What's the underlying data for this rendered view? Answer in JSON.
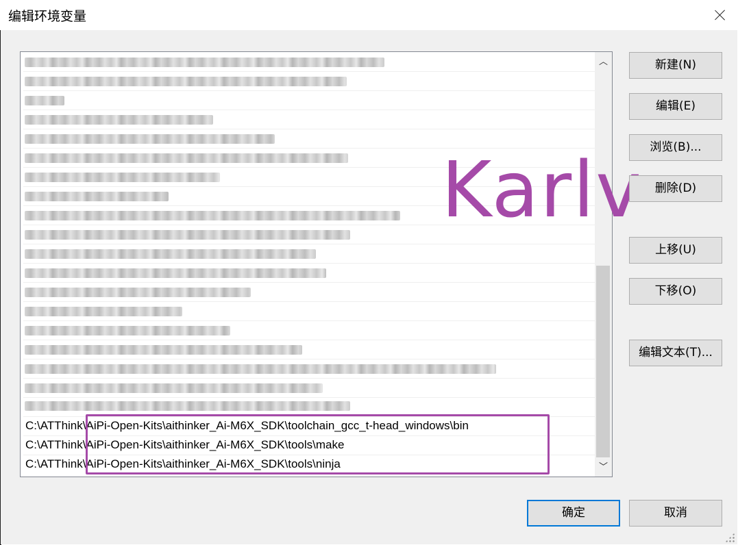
{
  "window": {
    "title": "编辑环境变量",
    "close_icon": "close-icon"
  },
  "list": {
    "visible_paths": [
      "C:\\ATThink\\AiPi-Open-Kits\\aithinker_Ai-M6X_SDK\\toolchain_gcc_t-head_windows\\bin",
      "C:\\ATThink\\AiPi-Open-Kits\\aithinker_Ai-M6X_SDK\\tools\\make",
      "C:\\ATThink\\AiPi-Open-Kits\\aithinker_Ai-M6X_SDK\\tools\\ninja"
    ],
    "scroll_up_icon": "chevron-up-icon",
    "scroll_down_icon": "chevron-down-icon"
  },
  "watermark": "Karlv",
  "buttons": {
    "new": "新建(N)",
    "edit": "编辑(E)",
    "browse": "浏览(B)...",
    "delete": "删除(D)",
    "move_up": "上移(U)",
    "move_down": "下移(O)",
    "edit_text": "编辑文本(T)...",
    "ok": "确定",
    "cancel": "取消"
  },
  "colors": {
    "highlight": "#a54aa8",
    "default_button_border": "#0078d7"
  }
}
